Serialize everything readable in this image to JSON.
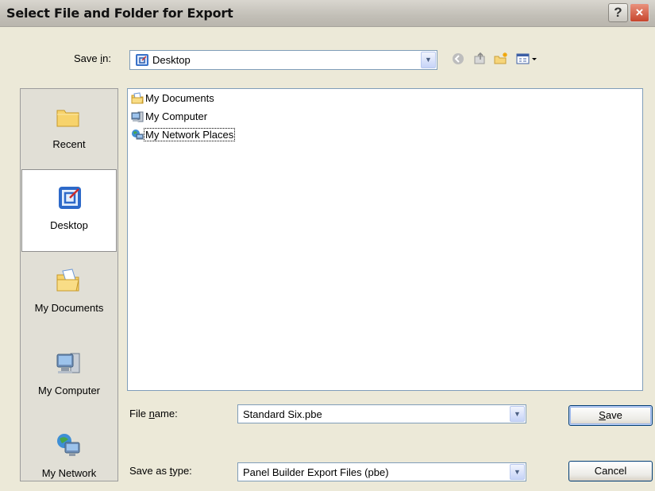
{
  "window": {
    "title": "Select File and Folder for Export"
  },
  "titlebar_buttons": {
    "help": "?",
    "close": "×"
  },
  "save_in": {
    "label_pre": "Save ",
    "label_key": "i",
    "label_post": "n:",
    "value": "Desktop"
  },
  "toolbar": [
    {
      "name": "back-icon",
      "glyph": "◀"
    },
    {
      "name": "up-folder-icon",
      "glyph": "⇧"
    },
    {
      "name": "new-folder-icon",
      "glyph": "✦"
    },
    {
      "name": "views-menu-icon",
      "glyph": "▦▾"
    }
  ],
  "places": [
    {
      "label": "Recent",
      "icon": "recent-folder-icon",
      "selected": false
    },
    {
      "label": "Desktop",
      "icon": "desktop-icon",
      "selected": true
    },
    {
      "label": "My Documents",
      "icon": "my-documents-icon",
      "selected": false
    },
    {
      "label": "My Computer",
      "icon": "my-computer-icon",
      "selected": false
    },
    {
      "label": "My Network",
      "icon": "my-network-icon",
      "selected": false
    }
  ],
  "files": [
    {
      "label": "My Documents",
      "icon": "my-documents-icon"
    },
    {
      "label": "My Computer",
      "icon": "my-computer-icon"
    },
    {
      "label": "My Network Places",
      "icon": "my-network-places-icon"
    }
  ],
  "file_name": {
    "label_pre": "File ",
    "label_key": "n",
    "label_post": "ame:",
    "value": "Standard Six.pbe"
  },
  "save_as_type": {
    "label_pre": "Save as ",
    "label_key": "t",
    "label_post": "ype:",
    "value": "Panel Builder Export Files (pbe)"
  },
  "buttons": {
    "save_key": "S",
    "save_rest": "ave",
    "cancel": "Cancel"
  },
  "colors": {
    "accent": "#7f9db9",
    "dialog_bg": "#ece9d8",
    "close_red": "#c7452d"
  }
}
